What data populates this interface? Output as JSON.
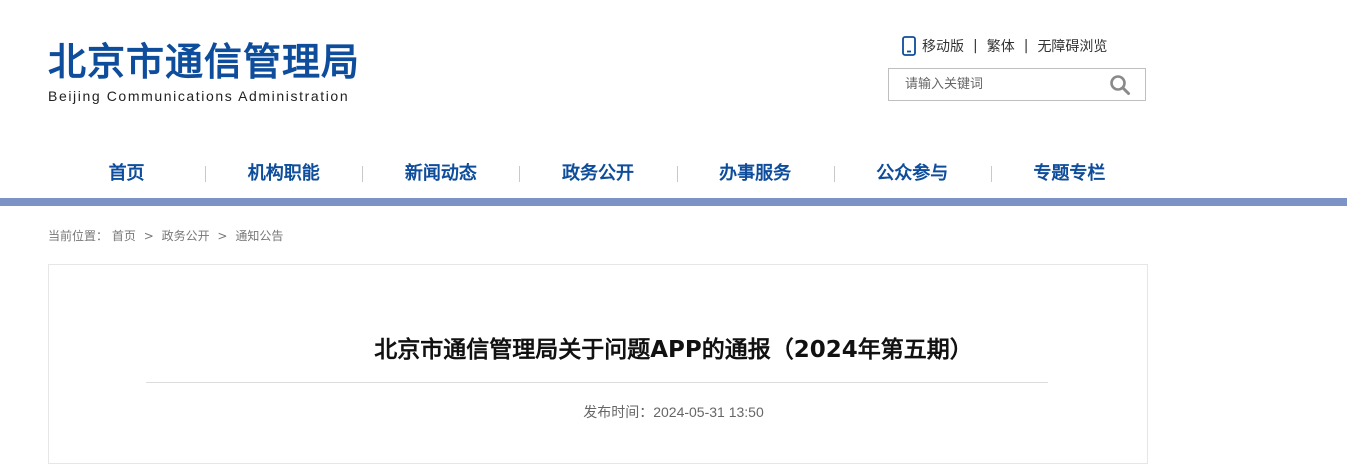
{
  "header": {
    "logo_cn": "北京市通信管理局",
    "logo_en": "Beijing Communications Administration",
    "links": {
      "mobile": "移动版",
      "traditional": "繁体",
      "accessible": "无障碍浏览"
    },
    "search": {
      "placeholder": "请输入关键词"
    },
    "brand_color": "#0e4d9b",
    "accent_bar_color": "#7b94c5"
  },
  "nav": {
    "items": [
      "首页",
      "机构职能",
      "新闻动态",
      "政务公开",
      "办事服务",
      "公众参与",
      "专题专栏"
    ]
  },
  "breadcrumb": {
    "prefix": "当前位置：",
    "items": [
      "首页",
      "政务公开",
      "通知公告"
    ],
    "separator": ">"
  },
  "article": {
    "title": "北京市通信管理局关于问题APP的通报（2024年第五期）",
    "publish_label": "发布时间：",
    "publish_time": "2024-05-31 13:50"
  }
}
